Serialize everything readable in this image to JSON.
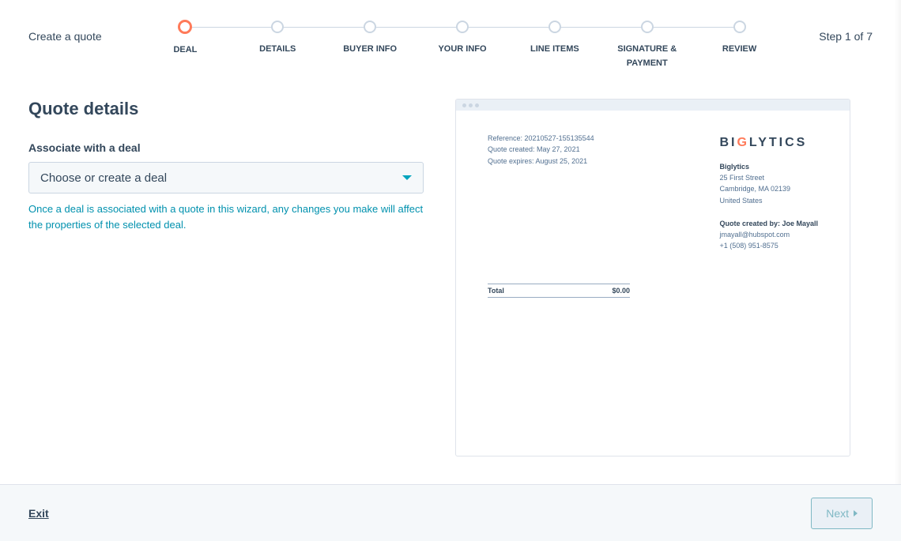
{
  "header": {
    "title": "Create a quote",
    "step_indicator": "Step 1 of 7"
  },
  "steps": [
    {
      "label": "DEAL",
      "active": true
    },
    {
      "label": "DETAILS",
      "active": false
    },
    {
      "label": "BUYER INFO",
      "active": false
    },
    {
      "label": "YOUR INFO",
      "active": false
    },
    {
      "label": "LINE ITEMS",
      "active": false
    },
    {
      "label": "SIGNATURE & PAYMENT",
      "active": false
    },
    {
      "label": "REVIEW",
      "active": false
    }
  ],
  "form": {
    "page_title": "Quote details",
    "deal_label": "Associate with a deal",
    "deal_placeholder": "Choose or create a deal",
    "help_text": "Once a deal is associated with a quote in this wizard, any changes you make will affect the properties of the selected deal."
  },
  "preview": {
    "reference": "Reference: 20210527-155135544",
    "created": "Quote created: May 27, 2021",
    "expires": "Quote expires: August 25, 2021",
    "company_name": "Biglytics",
    "address1": "25 First Street",
    "address2": "Cambridge, MA 02139",
    "country": "United States",
    "created_by_label": "Quote created by: Joe Mayall",
    "email": "jmayall@hubspot.com",
    "phone": "+1 (508) 951-8575",
    "total_label": "Total",
    "total_value": "$0.00"
  },
  "footer": {
    "exit": "Exit",
    "next": "Next"
  }
}
